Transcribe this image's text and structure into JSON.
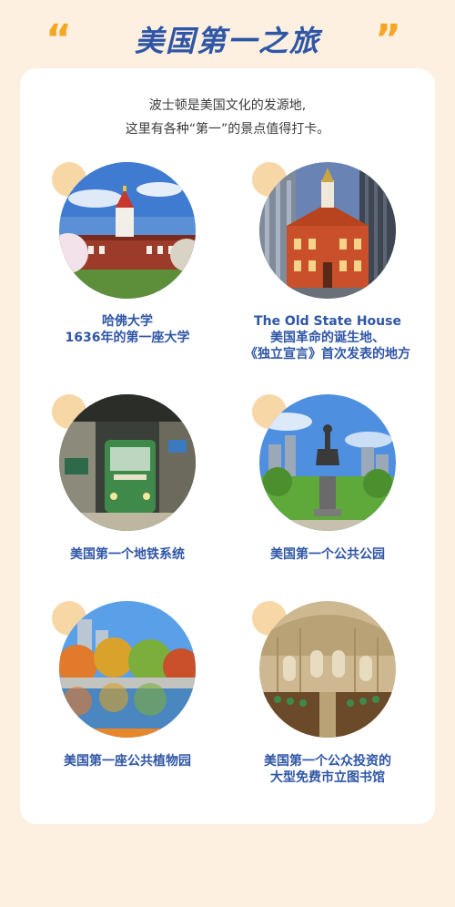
{
  "header": {
    "quote_left": "“",
    "quote_right": "”",
    "title": "美国第一之旅"
  },
  "intro": {
    "line1": "波士顿是美国文化的发源地,",
    "line2": "这里有各种“第一”的景点值得打卡。"
  },
  "spots": [
    {
      "line1": "哈佛大学",
      "line2": "1636年的第一座大学",
      "line3": ""
    },
    {
      "line1": "The Old State House",
      "line2": "美国革命的诞生地、",
      "line3": "《独立宣言》首次发表的地方"
    },
    {
      "line1": "美国第一个地铁系统",
      "line2": "",
      "line3": ""
    },
    {
      "line1": "美国第一个公共公园",
      "line2": "",
      "line3": ""
    },
    {
      "line1": "美国第一座公共植物园",
      "line2": "",
      "line3": ""
    },
    {
      "line1": "美国第一个公众投资的",
      "line2": "大型免费市立图书馆",
      "line3": ""
    }
  ],
  "colors": {
    "accent": "#f5a623",
    "title": "#2f56a6",
    "background": "#fdf0e0",
    "dot": "#f7d7a6"
  }
}
